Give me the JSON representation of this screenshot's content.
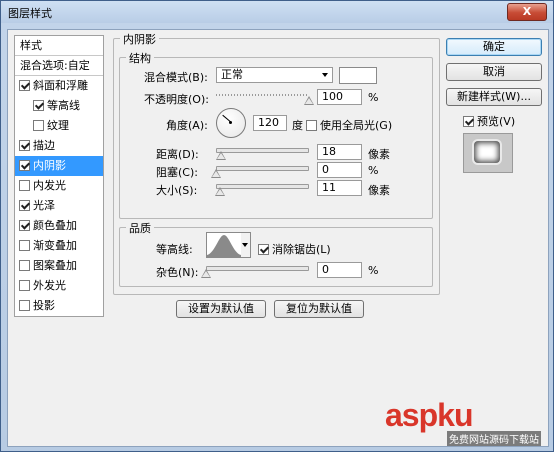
{
  "window": {
    "title": "图层样式",
    "close_label": "X"
  },
  "style_list": {
    "header": "样式",
    "blend_options": "混合选项:自定",
    "items": [
      {
        "label": "斜面和浮雕",
        "checked": true,
        "indent": false,
        "selected": false
      },
      {
        "label": "等高线",
        "checked": true,
        "indent": true,
        "selected": false
      },
      {
        "label": "纹理",
        "checked": false,
        "indent": true,
        "selected": false
      },
      {
        "label": "描边",
        "checked": true,
        "indent": false,
        "selected": false
      },
      {
        "label": "内阴影",
        "checked": true,
        "indent": false,
        "selected": true
      },
      {
        "label": "内发光",
        "checked": false,
        "indent": false,
        "selected": false
      },
      {
        "label": "光泽",
        "checked": true,
        "indent": false,
        "selected": false
      },
      {
        "label": "颜色叠加",
        "checked": true,
        "indent": false,
        "selected": false
      },
      {
        "label": "渐变叠加",
        "checked": false,
        "indent": false,
        "selected": false
      },
      {
        "label": "图案叠加",
        "checked": false,
        "indent": false,
        "selected": false
      },
      {
        "label": "外发光",
        "checked": false,
        "indent": false,
        "selected": false
      },
      {
        "label": "投影",
        "checked": false,
        "indent": false,
        "selected": false
      }
    ]
  },
  "inner_shadow": {
    "title": "内阴影",
    "structure": {
      "title": "结构",
      "blend_mode_label": "混合模式(B):",
      "blend_mode_value": "正常",
      "blend_color": "#ffffff",
      "opacity_label": "不透明度(O):",
      "opacity_value": "100",
      "opacity_unit": "%",
      "opacity_fraction": 1.0,
      "angle_label": "角度(A):",
      "angle_value": "120",
      "angle_unit": "度",
      "global_light_label": "使用全局光(G)",
      "global_light_checked": false,
      "distance_label": "距离(D):",
      "distance_value": "18",
      "distance_unit": "像素",
      "distance_fraction": 0.06,
      "choke_label": "阻塞(C):",
      "choke_value": "0",
      "choke_unit": "%",
      "choke_fraction": 0.0,
      "size_label": "大小(S):",
      "size_value": "11",
      "size_unit": "像素",
      "size_fraction": 0.04
    },
    "quality": {
      "title": "品质",
      "contour_label": "等高线:",
      "antialias_label": "消除锯齿(L)",
      "antialias_checked": true,
      "noise_label": "杂色(N):",
      "noise_value": "0",
      "noise_unit": "%",
      "noise_fraction": 0.0
    },
    "set_default_label": "设置为默认值",
    "reset_default_label": "复位为默认值"
  },
  "buttons": {
    "ok": "确定",
    "cancel": "取消",
    "new_style": "新建样式(W)...",
    "preview_label": "预览(V)",
    "preview_checked": true
  },
  "watermark": {
    "main": "aspku",
    "sub": "免费网站源码下载站"
  }
}
